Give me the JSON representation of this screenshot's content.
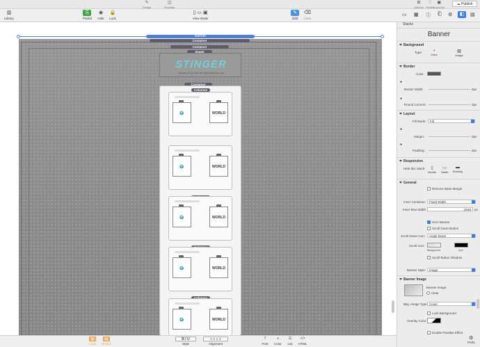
{
  "titlebar": {
    "design": "Design",
    "simulate": "Simulate",
    "publish": "Publish",
    "addons": "Addons",
    "health": "Health",
    "inspector": "Inspector"
  },
  "toolbar": {
    "library": "Library",
    "partial": "Partial",
    "hide": "Hide",
    "lock": "Lock",
    "view_mode": "View Mode",
    "edit": "Edit",
    "clear": "Clear"
  },
  "canvas": {
    "banner": "Banner",
    "container": "Container",
    "image": "Image",
    "columns": "Columns",
    "logo": "STINGER",
    "tagline": "speeding up your site with high-performance web",
    "world": "WORLD"
  },
  "bottombar": {
    "lock": "Lock",
    "unlock": "Unlock",
    "style": "Style",
    "alignment": "Alignment",
    "font": "Font",
    "color": "Color",
    "list": "List",
    "html": "HTML"
  },
  "inspector": {
    "panel_title": "Stacks",
    "stack_name": "Banner",
    "background": {
      "section": "Background",
      "type_label": "Type:",
      "type_color": "Color",
      "type_image": "Image"
    },
    "border": {
      "section": "Border",
      "color_label": "Color:",
      "width_label": "Border Width:",
      "width_value": "0px",
      "round_label": "Round Corners:",
      "round_value": "0px"
    },
    "layout": {
      "section": "Layout",
      "fill_label": "Fill Mode:",
      "fill_value": "Fill",
      "margin_label": "Margin:",
      "margin_value": "0px",
      "padding_label": "Padding:",
      "padding_value": "0px"
    },
    "responsive": {
      "section": "Responsive",
      "hide_label": "Hide this Stack:",
      "mobile": "Mobile",
      "tablet": "Tablet",
      "desktop": "Desktop"
    },
    "general": {
      "section": "General",
      "remove_margin": "Remove Base Margin",
      "inner_container_label": "Inner Container:",
      "inner_container_value": "Fixed-Width",
      "inner_max_label": "Inner Max-Width:",
      "inner_max_value": "2048",
      "inner_max_unit": "px",
      "hero_banner": "Hero Banner",
      "scroll_down_btn": "Scroll Down Button",
      "scroll_icon_label": "Scroll Down Icon:",
      "scroll_icon_value": "Angle Down",
      "scroll_colors_label": "Scroll Icon:",
      "bg_label": "Background",
      "icon_label": "Icon",
      "scroll_shadow": "Scroll Button Shadow",
      "banner_style_label": "Banner Style:",
      "banner_style_value": "Image"
    },
    "banner_image": {
      "section": "Banner Image",
      "image_label": "Banner Image:",
      "clear": "Clear",
      "bkg_type_label": "Bkg. Image Type:",
      "bkg_type_value": "Cover",
      "lock_bg": "Lock Background",
      "overlay_label": "Overlay Color:",
      "parallax": "Enable Parallax Effect"
    },
    "prefs": "Prefs"
  },
  "colors": {
    "accent": "#4a7fe0",
    "green": "#3aa63a",
    "orange": "#f0a040"
  }
}
